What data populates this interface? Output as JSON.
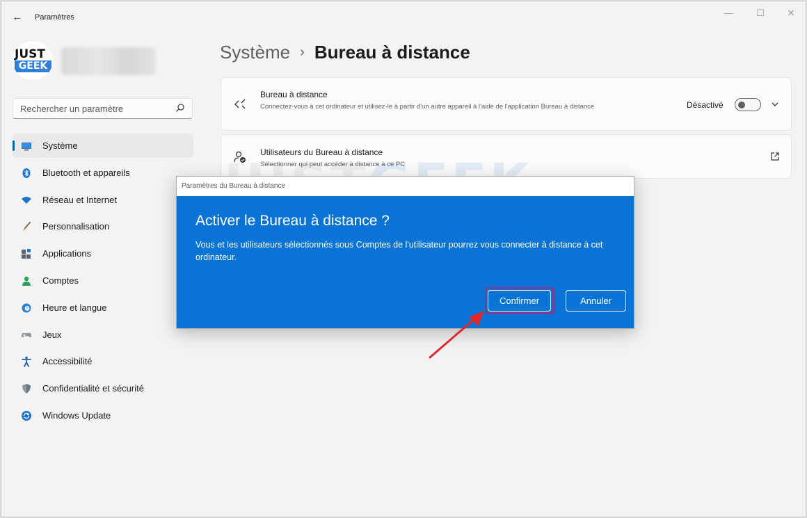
{
  "window": {
    "title": "Paramètres",
    "back_label": "←",
    "controls": {
      "minimize": "—",
      "maximize": "☐",
      "close": "✕"
    }
  },
  "profile": {
    "logo_top": "JUST",
    "logo_bottom": "GEEK"
  },
  "search": {
    "placeholder": "Rechercher un paramètre"
  },
  "nav": {
    "items": [
      {
        "label": "Système",
        "icon": "monitor-icon",
        "active": true
      },
      {
        "label": "Bluetooth et appareils",
        "icon": "bluetooth-icon"
      },
      {
        "label": "Réseau et Internet",
        "icon": "wifi-icon"
      },
      {
        "label": "Personnalisation",
        "icon": "brush-icon"
      },
      {
        "label": "Applications",
        "icon": "apps-icon"
      },
      {
        "label": "Comptes",
        "icon": "person-icon"
      },
      {
        "label": "Heure et langue",
        "icon": "clock-globe-icon"
      },
      {
        "label": "Jeux",
        "icon": "gamepad-icon"
      },
      {
        "label": "Accessibilité",
        "icon": "accessibility-icon"
      },
      {
        "label": "Confidentialité et sécurité",
        "icon": "shield-icon"
      },
      {
        "label": "Windows Update",
        "icon": "update-icon"
      }
    ]
  },
  "header": {
    "parent": "Système",
    "separator": "›",
    "current": "Bureau à distance"
  },
  "cards": {
    "remote": {
      "title": "Bureau à distance",
      "description": "Connectez-vous à cet ordinateur et utilisez-le à partir d'un autre appareil à l'aide de l'application Bureau à distance",
      "toggle_label": "Désactivé",
      "toggle_on": false
    },
    "users": {
      "title": "Utilisateurs du Bureau à distance",
      "description": "Sélectionner qui peut accéder à distance à ce PC"
    }
  },
  "dialog": {
    "window_title": "Paramètres du Bureau à distance",
    "heading": "Activer le Bureau à distance ?",
    "body": "Vous et les utilisateurs sélectionnés sous Comptes de l'utilisateur pourrez vous connecter à distance à cet ordinateur.",
    "confirm_label": "Confirmer",
    "cancel_label": "Annuler"
  },
  "watermark": {
    "left": "JUST",
    "right": "GEEK"
  },
  "colors": {
    "accent": "#0067c0",
    "dialog_bg": "#0a74d6",
    "highlight": "#7b3e93",
    "arrow": "#e3262a"
  }
}
